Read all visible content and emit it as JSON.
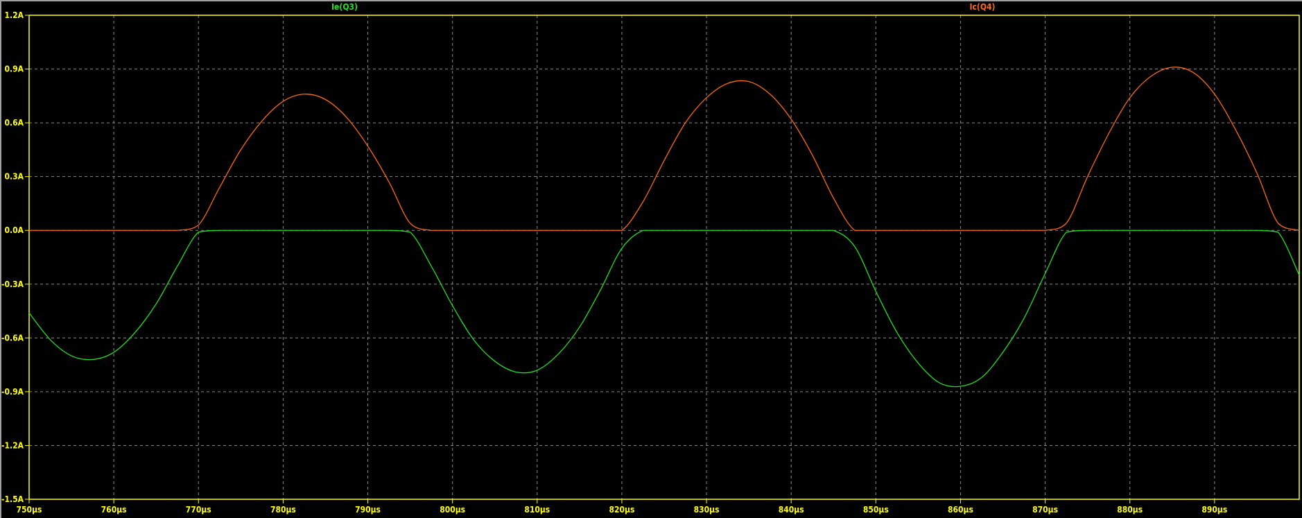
{
  "chart_data": {
    "type": "line",
    "title": "",
    "xlabel": "",
    "ylabel": "",
    "x_unit": "µs",
    "y_unit": "A",
    "xlim": [
      750,
      900
    ],
    "ylim": [
      -1.5,
      1.2
    ],
    "grid": true,
    "x_ticks": [
      750,
      760,
      770,
      780,
      790,
      800,
      810,
      820,
      830,
      840,
      850,
      860,
      870,
      880,
      890
    ],
    "x_tick_labels": [
      "750µs",
      "760µs",
      "770µs",
      "780µs",
      "790µs",
      "800µs",
      "810µs",
      "820µs",
      "830µs",
      "840µs",
      "850µs",
      "860µs",
      "870µs",
      "880µs",
      "890µs"
    ],
    "y_ticks": [
      1.2,
      0.9,
      0.6,
      0.3,
      0.0,
      -0.3,
      -0.6,
      -0.9,
      -1.2,
      -1.5
    ],
    "y_tick_labels": [
      "1.2A",
      "0.9A",
      "0.6A",
      "0.3A",
      "0.0A",
      "-0.3A",
      "-0.6A",
      "-0.9A",
      "-1.2A",
      "-1.5A"
    ],
    "x_start": 750,
    "x_step": 2.5,
    "series": [
      {
        "name": "Ie(Q3)",
        "color": "#22e022",
        "values": [
          -0.46,
          -0.61,
          -0.7,
          -0.72,
          -0.68,
          -0.57,
          -0.41,
          -0.2,
          -0.01,
          0,
          0,
          0,
          0,
          0,
          0,
          0,
          0,
          0,
          -0.01,
          -0.2,
          -0.42,
          -0.61,
          -0.73,
          -0.79,
          -0.78,
          -0.69,
          -0.54,
          -0.33,
          -0.1,
          0,
          0,
          0,
          0,
          0,
          0,
          0,
          0,
          0,
          0,
          -0.09,
          -0.34,
          -0.57,
          -0.74,
          -0.85,
          -0.87,
          -0.82,
          -0.68,
          -0.49,
          -0.24,
          -0.01,
          0,
          0,
          0,
          0,
          0,
          0,
          0,
          0,
          0,
          -0.01,
          -0.25
        ]
      },
      {
        "name": "Ic(Q4)",
        "color": "#ff6a10",
        "values": [
          0,
          0,
          0,
          0,
          0,
          0,
          0,
          0,
          0.03,
          0.24,
          0.45,
          0.61,
          0.72,
          0.76,
          0.73,
          0.63,
          0.47,
          0.27,
          0.04,
          0,
          0,
          0,
          0,
          0,
          0,
          0,
          0,
          0,
          0,
          0.16,
          0.39,
          0.6,
          0.74,
          0.82,
          0.83,
          0.76,
          0.62,
          0.42,
          0.18,
          0,
          0,
          0,
          0,
          0,
          0,
          0,
          0,
          0,
          0,
          0.04,
          0.3,
          0.54,
          0.74,
          0.86,
          0.91,
          0.88,
          0.76,
          0.56,
          0.32,
          0.04,
          0
        ]
      }
    ],
    "axis_color": "#ffff00",
    "grid_color": "#8a8a8a",
    "legend": "top (trace labels above plot)"
  }
}
